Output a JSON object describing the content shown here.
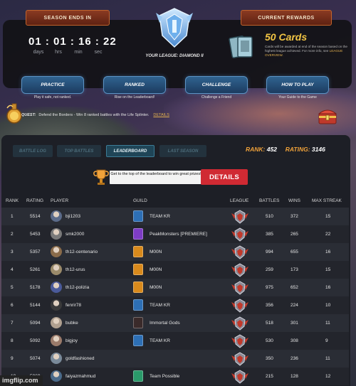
{
  "header": {
    "season_ends_label": "SEASON ENDS IN",
    "timer": "01 : 01 : 16 : 22",
    "timer_units": [
      "days",
      "hrs",
      "min",
      "sec"
    ],
    "league_label": "YOUR LEAGUE: DIAMOND II",
    "current_rewards_label": "CURRENT REWARDS",
    "cards_title": "50 Cards",
    "cards_desc": "Cards will be awarded at end of the season based on the highest league achieved. For more info, see",
    "cards_link": "LEAGUE OVERVIEW."
  },
  "actions": [
    {
      "label": "PRACTICE",
      "sub": "Play it safe, not ranked."
    },
    {
      "label": "RANKED",
      "sub": "Rise on the Leaderboard!"
    },
    {
      "label": "CHALLENGE",
      "sub": "Challenge a Friend"
    },
    {
      "label": "HOW TO PLAY",
      "sub": "Your Guide to the Game"
    }
  ],
  "quest": {
    "label": "QUEST:",
    "text": "Defend the Borders - Win 8 ranked battles with the Life Splinter.",
    "details": "DETAILS"
  },
  "tabs": [
    "BATTLE LOG",
    "TOP BATTLES",
    "LEADERBOARD",
    "LAST SEASON"
  ],
  "active_tab": 2,
  "summary": {
    "rank_label": "RANK:",
    "rank": "452",
    "rating_label": "RATING:",
    "rating": "3146"
  },
  "promo": {
    "text": "Get to the top of the leaderboard to win great prizes!",
    "button": "DETAILS"
  },
  "columns": [
    "RANK",
    "RATING",
    "PLAYER",
    "GUILD",
    "LEAGUE",
    "BATTLES",
    "WINS",
    "MAX STREAK"
  ],
  "rows": [
    {
      "rank": "1",
      "rating": "5514",
      "player": "bji1203",
      "guild": "TEAM KR",
      "battles": "510",
      "wins": "372",
      "streak": "15"
    },
    {
      "rank": "2",
      "rating": "5453",
      "player": "smk2000",
      "guild": "PeakMonsters [PREMIERE]",
      "battles": "385",
      "wins": "265",
      "streak": "22"
    },
    {
      "rank": "3",
      "rating": "5357",
      "player": "th12-centenario",
      "guild": "M00N",
      "battles": "994",
      "wins": "655",
      "streak": "16"
    },
    {
      "rank": "4",
      "rating": "5261",
      "player": "th12-urus",
      "guild": "M00N",
      "battles": "259",
      "wins": "173",
      "streak": "15"
    },
    {
      "rank": "5",
      "rating": "5178",
      "player": "th12-polizia",
      "guild": "M00N",
      "battles": "975",
      "wins": "652",
      "streak": "16"
    },
    {
      "rank": "6",
      "rating": "5144",
      "player": "fenrir78",
      "guild": "TEAM KR",
      "battles": "356",
      "wins": "224",
      "streak": "10"
    },
    {
      "rank": "7",
      "rating": "5094",
      "player": "bubke",
      "guild": "Immortal Gods",
      "battles": "518",
      "wins": "301",
      "streak": "11"
    },
    {
      "rank": "8",
      "rating": "5092",
      "player": "bigjoy",
      "guild": "TEAM KR",
      "battles": "530",
      "wins": "308",
      "streak": "9"
    },
    {
      "rank": "9",
      "rating": "5074",
      "player": "goldfashioned",
      "guild": "",
      "battles": "350",
      "wins": "236",
      "streak": "11"
    },
    {
      "rank": "10",
      "rating": "5069",
      "player": "faiyazmahmud",
      "guild": "Team Possible",
      "battles": "215",
      "wins": "128",
      "streak": "12"
    }
  ],
  "watermark": "imgflip.com",
  "colors": {
    "accent_orange": "#f0a23a",
    "details_red": "#d02a33",
    "card_gold": "#f2c544"
  }
}
